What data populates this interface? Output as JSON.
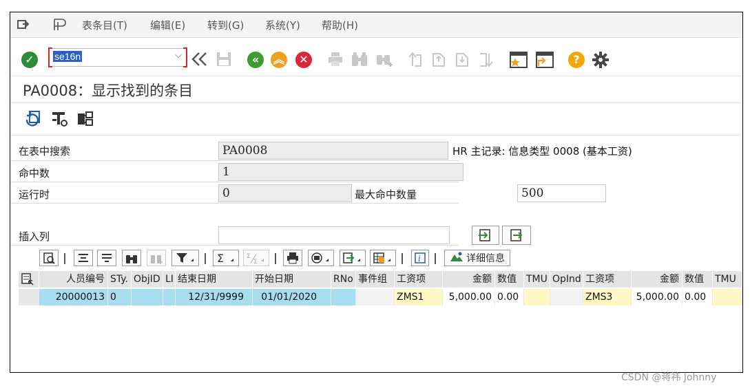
{
  "menu": {
    "items": [
      "表条目(T)",
      "编辑(E)",
      "转到(G)",
      "系统(Y)",
      "帮助(H)"
    ]
  },
  "command": {
    "value": "se16n"
  },
  "page_title": "PA0008：显示找到的条目",
  "form": {
    "search_table_label": "在表中搜索",
    "search_table_value": "PA0008",
    "search_table_desc": "HR 主记录: 信息类型 0008 (基本工资)",
    "hits_label": "命中数",
    "hits_value": "1",
    "runtime_label": "运行时",
    "runtime_value": "0",
    "max_hits_label": "最大命中数量",
    "max_hits_value": "500",
    "insert_col_label": "插入列"
  },
  "grid_toolbar": {
    "details_label": "详细信息"
  },
  "table": {
    "headers": [
      "人员编号",
      "STy.",
      "ObjID",
      "LI",
      "结束日期",
      "开始日期",
      "RNo",
      "事件组",
      "工资项",
      "金额",
      "数值",
      "TMU",
      "OpInd",
      "工资项",
      "金额",
      "数值",
      "TMU"
    ],
    "row": [
      "20000013",
      "0",
      "",
      "",
      "12/31/9999",
      "01/01/2020",
      "",
      "",
      "ZMS1",
      "5,000.00",
      "0.00",
      "",
      "",
      "ZMS3",
      "5,000.00",
      "0.00",
      ""
    ]
  },
  "watermark": "CSDN @蒋祎 Johnny",
  "colors": {
    "ok_green": "#2e8b3a",
    "nav_green": "#3e9b2f",
    "nav_orange": "#f0a020",
    "cancel_red": "#d8283a",
    "help_orange": "#f2a60c",
    "key_col": "#a8dcef",
    "amount_col": "#fff8c4"
  }
}
